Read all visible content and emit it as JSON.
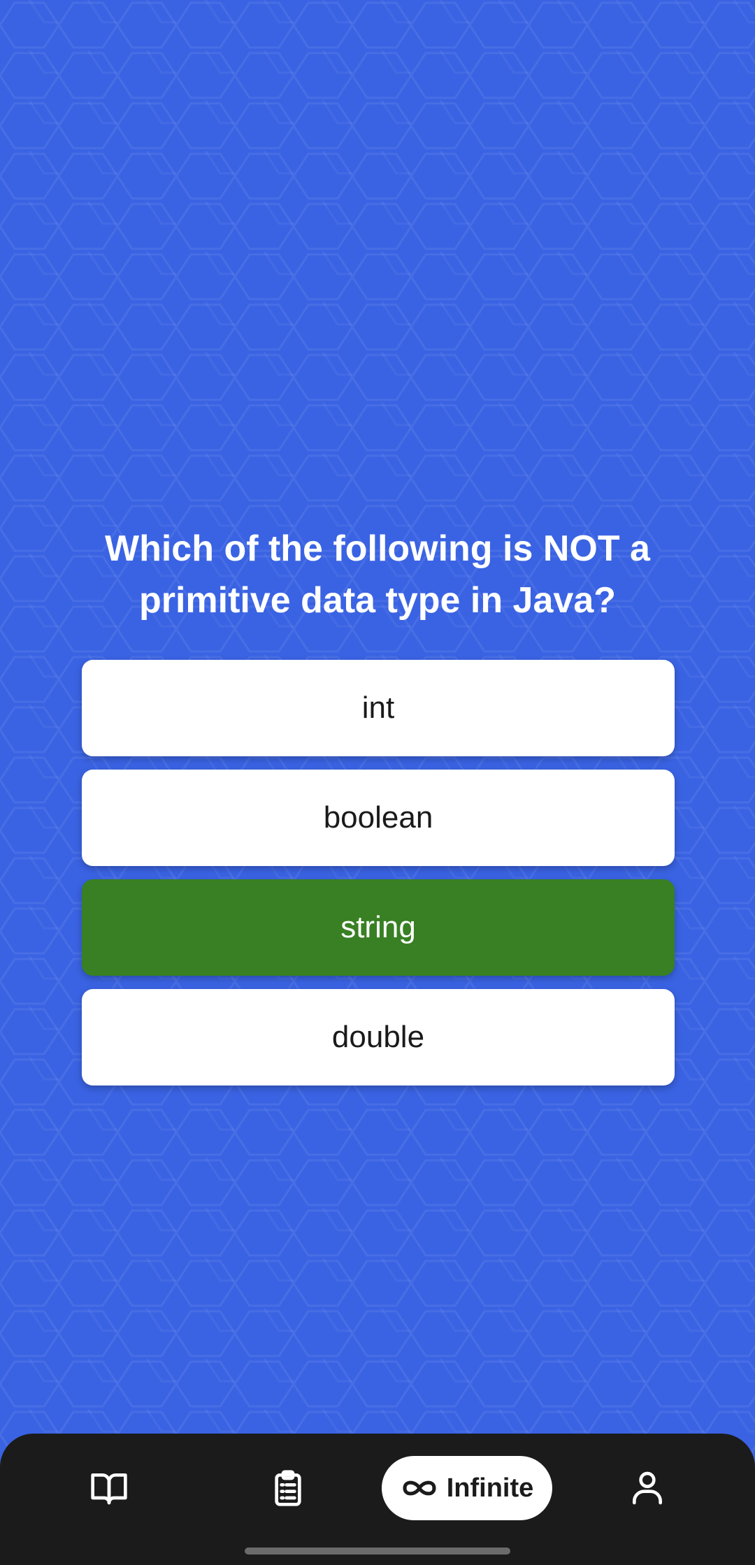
{
  "quiz": {
    "question": "Which of the following is NOT a primitive data type in Java?",
    "options": [
      {
        "label": "int",
        "state": "default"
      },
      {
        "label": "boolean",
        "state": "default"
      },
      {
        "label": "string",
        "state": "correct"
      },
      {
        "label": "double",
        "state": "default"
      }
    ]
  },
  "nav": {
    "items": [
      {
        "icon": "book-icon"
      },
      {
        "icon": "clipboard-icon"
      },
      {
        "icon": "infinity-icon",
        "label": "Infinite",
        "selected": true
      },
      {
        "icon": "person-icon"
      }
    ]
  },
  "colors": {
    "background": "#3a63e3",
    "correct": "#388023",
    "option_default": "#ffffff",
    "navbar": "#1b1b1b"
  }
}
